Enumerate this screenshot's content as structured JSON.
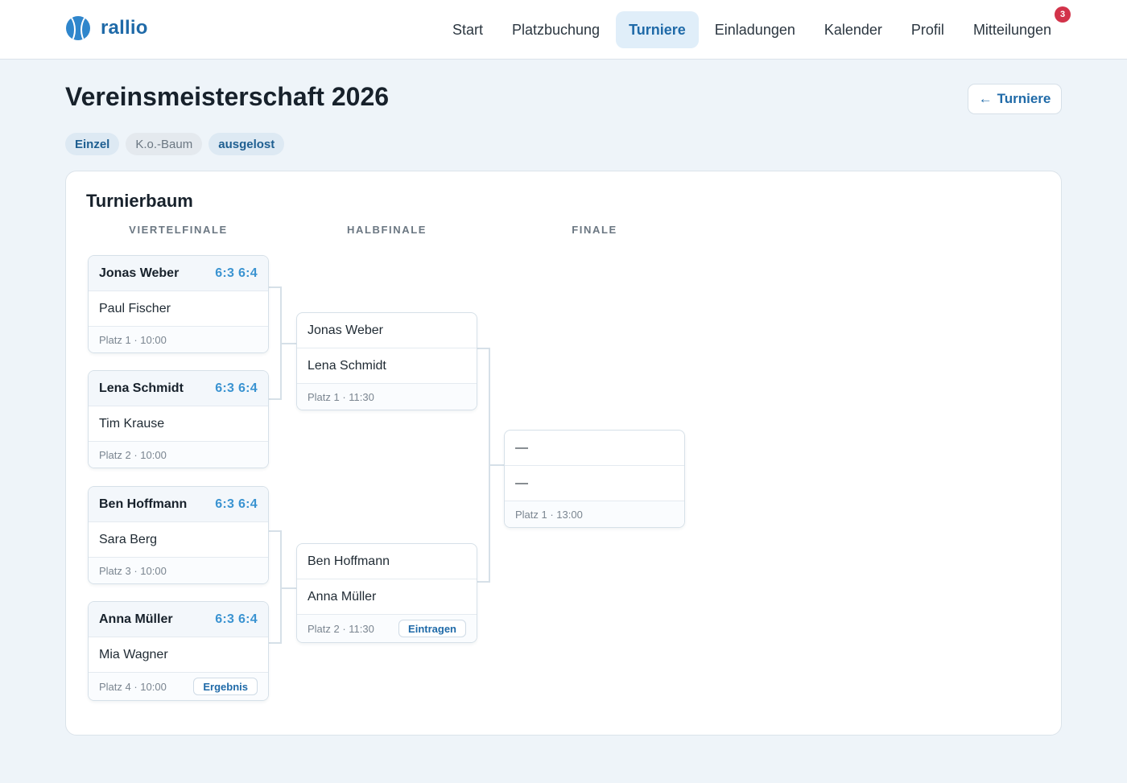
{
  "header": {
    "logo_text": "rallio",
    "nav": [
      {
        "label": "Start"
      },
      {
        "label": "Platzbuchung"
      },
      {
        "label": "Turniere"
      },
      {
        "label": "Einladungen"
      },
      {
        "label": "Kalender"
      },
      {
        "label": "Profil"
      },
      {
        "label": "Mitteilungen",
        "badge": "3"
      }
    ],
    "active_nav": "Turniere"
  },
  "page": {
    "title": "Vereinsmeisterschaft 2026",
    "back_label": "Turniere",
    "tags": [
      "Einzel",
      "K.o.-Baum",
      "ausgelost"
    ]
  },
  "bracket": {
    "title": "Turnierbaum",
    "rounds": [
      "VIERTELFINALE",
      "HALBFINALE",
      "FINALE"
    ],
    "quarterfinals": [
      {
        "p1": "Jonas Weber",
        "score": "6:3 6:4",
        "p2": "Paul Fischer",
        "meta": "Platz 1 · 10:00"
      },
      {
        "p1": "Lena Schmidt",
        "score": "6:3 6:4",
        "p2": "Tim Krause",
        "meta": "Platz 2 · 10:00"
      },
      {
        "p1": "Ben Hoffmann",
        "score": "6:3 6:4",
        "p2": "Sara Berg",
        "meta": "Platz 3 · 10:00"
      },
      {
        "p1": "Anna Müller",
        "score": "6:3 6:4",
        "p2": "Mia Wagner",
        "meta": "Platz 4 · 10:00",
        "action": "Ergebnis"
      }
    ],
    "semifinals": [
      {
        "p1": "Jonas Weber",
        "p2": "Lena Schmidt",
        "meta": "Platz 1 · 11:30"
      },
      {
        "p1": "Ben Hoffmann",
        "p2": "Anna Müller",
        "meta": "Platz 2 · 11:30",
        "action": "Eintragen"
      }
    ],
    "final": {
      "p1": "—",
      "p2": "—",
      "meta": "Platz 1 · 13:00"
    }
  },
  "colors": {
    "accent": "#1f6aa8",
    "score": "#3a93d1",
    "badge": "#d2334a",
    "active_nav_bg": "#e0eef9"
  }
}
